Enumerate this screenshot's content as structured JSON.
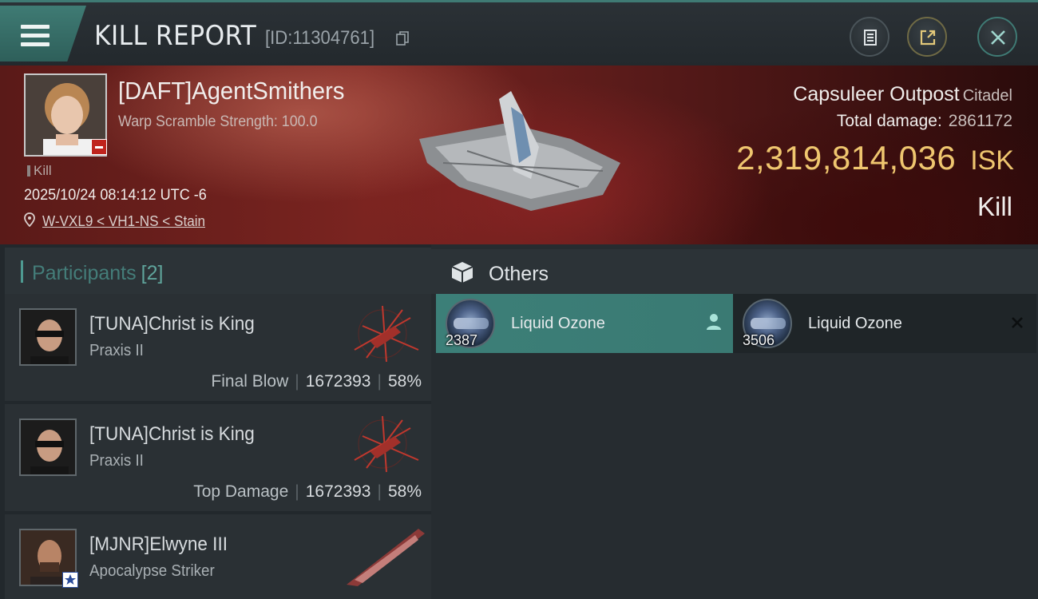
{
  "header": {
    "title": "KILL REPORT",
    "report_id": "[ID:11304761]"
  },
  "victim": {
    "name": "[DAFT]AgentSmithers",
    "scramble": "Warp Scramble Strength: 100.0",
    "kill_tag": "Kill",
    "datetime": "2025/10/24 08:14:12 UTC -6",
    "location": "W-VXL9 < VH1-NS < Stain",
    "structure_name": "Capsuleer Outpost",
    "structure_type": "Citadel",
    "total_damage_label": "Total damage:",
    "total_damage": "2861172",
    "isk_value": "2,319,814,036",
    "isk_unit": "ISK",
    "result": "Kill"
  },
  "participants": {
    "label": "Participants",
    "count": "[2]",
    "rows": [
      {
        "name": "[TUNA]Christ is King",
        "ship": "Praxis II",
        "role": "Final Blow",
        "damage": "1672393",
        "percent": "58%"
      },
      {
        "name": "[TUNA]Christ is King",
        "ship": "Praxis II",
        "role": "Top Damage",
        "damage": "1672393",
        "percent": "58%"
      },
      {
        "name": "[MJNR]Elwyne III",
        "ship": "Apocalypse Striker"
      }
    ]
  },
  "others": {
    "label": "Others",
    "items": [
      {
        "qty": "2387",
        "name": "Liquid Ozone"
      },
      {
        "qty": "3506",
        "name": "Liquid Ozone"
      }
    ]
  },
  "colors": {
    "accent_teal": "#3f7b74",
    "isk_gold": "#efc66f",
    "hero_red": "#7a2420"
  },
  "icons": {
    "menu": "hamburger-menu-icon",
    "copy": "copy-icon",
    "document": "document-icon",
    "share": "share-icon",
    "close": "close-icon",
    "location": "location-pin-icon",
    "box": "box-icon",
    "person": "person-icon",
    "destroyed": "x-icon"
  }
}
